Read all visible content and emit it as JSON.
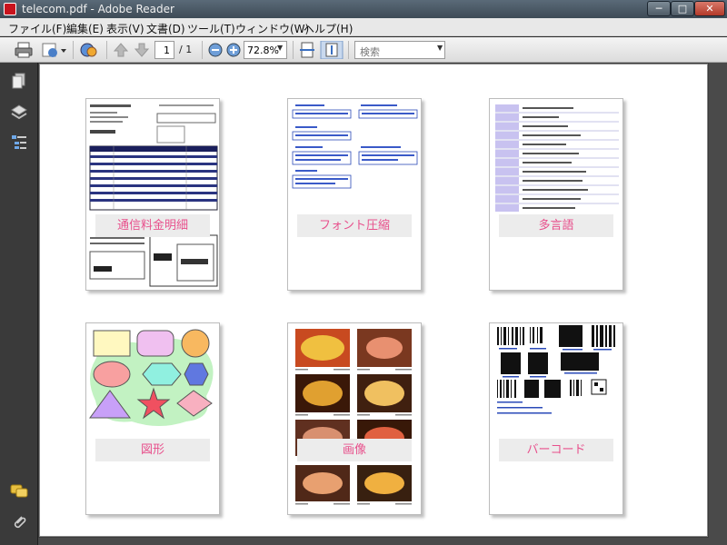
{
  "window": {
    "title": "telecom.pdf - Adobe Reader",
    "minimize": "─",
    "maximize": "□",
    "close": "✕"
  },
  "menu": [
    "ファイル(F)",
    "編集(E)",
    "表示(V)",
    "文書(D)",
    "ツール(T)",
    "ウィンドウ(W)",
    "ヘルプ(H)"
  ],
  "toolbar": {
    "current_page": "1",
    "total_pages": "/ 1",
    "zoom": "72.8%",
    "search_placeholder": "検索"
  },
  "thumbnails": [
    {
      "label": "通信料金明細"
    },
    {
      "label": "フォント圧縮"
    },
    {
      "label": "多言語"
    },
    {
      "label": "図形"
    },
    {
      "label": "画像"
    },
    {
      "label": "バーコード"
    }
  ],
  "colors": {
    "label_text": "#e8508c",
    "label_bg": "#ececec",
    "toolbar_bg": "#e4e4e4",
    "sidebar_bg": "#3a3a3a"
  }
}
